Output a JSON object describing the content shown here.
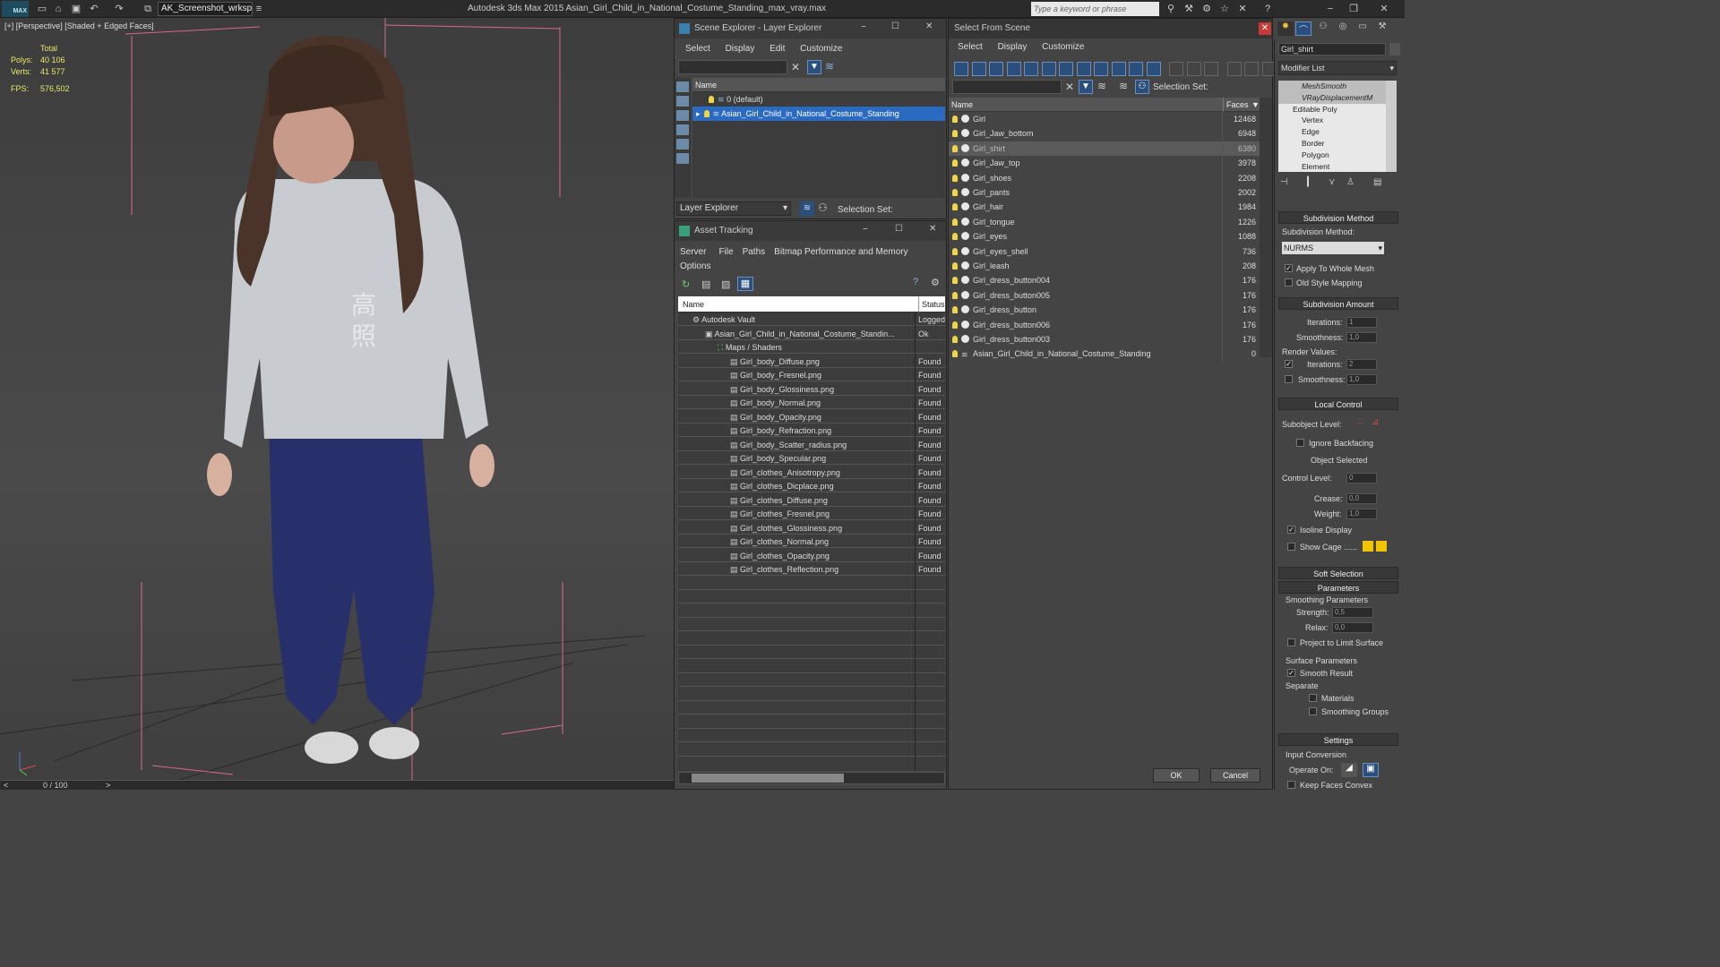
{
  "app": {
    "logo": "MAX",
    "workspace": "AK_Screenshot_wrksp",
    "title": "Autodesk 3ds Max  2015      Asian_Girl_Child_in_National_Costume_Standing_max_vray.max",
    "search_placeholder": "Type a keyword or phrase"
  },
  "viewport": {
    "label": "[+] [Perspective] [Shaded + Edged Faces]",
    "stats": {
      "total_label": "Total",
      "polys_label": "Polys:",
      "polys": "40 106",
      "verts_label": "Verts:",
      "verts": "41 577",
      "fps_label": "FPS:",
      "fps": "576,502"
    },
    "chars": [
      "高",
      "照"
    ]
  },
  "timeline": {
    "frame": "0 / 100",
    "left": "<",
    "right": ">"
  },
  "scene_explorer": {
    "title": "Scene Explorer - Layer Explorer",
    "menu": [
      "Select",
      "Display",
      "Edit",
      "Customize"
    ],
    "col_name": "Name",
    "layers": [
      "0 (default)",
      "Asian_Girl_Child_in_National_Costume_Standing"
    ],
    "footer_dropdown": "Layer Explorer",
    "footer_selset": "Selection Set:"
  },
  "asset_tracking": {
    "title": "Asset Tracking",
    "menu": [
      "Server",
      "File",
      "Paths",
      "Bitmap Performance and Memory",
      "Options"
    ],
    "col_name": "Name",
    "col_status": "Status",
    "rows": [
      {
        "name": "Autodesk Vault",
        "status": "Logged",
        "indent": 1
      },
      {
        "name": "Asian_Girl_Child_in_National_Costume_Standin...",
        "status": "Ok",
        "indent": 2
      },
      {
        "name": "Maps / Shaders",
        "status": "",
        "indent": 3
      },
      {
        "name": "Girl_body_Diffuse.png",
        "status": "Found",
        "indent": 4
      },
      {
        "name": "Girl_body_Fresnel.png",
        "status": "Found",
        "indent": 4
      },
      {
        "name": "Girl_body_Glossiness.png",
        "status": "Found",
        "indent": 4
      },
      {
        "name": "Girl_body_Normal.png",
        "status": "Found",
        "indent": 4
      },
      {
        "name": "Girl_body_Opacity.png",
        "status": "Found",
        "indent": 4
      },
      {
        "name": "Girl_body_Refraction.png",
        "status": "Found",
        "indent": 4
      },
      {
        "name": "Girl_body_Scatter_radius.png",
        "status": "Found",
        "indent": 4
      },
      {
        "name": "Girl_body_Specular.png",
        "status": "Found",
        "indent": 4
      },
      {
        "name": "Girl_clothes_Anisotropy.png",
        "status": "Found",
        "indent": 4
      },
      {
        "name": "Girl_clothes_Dicplace.png",
        "status": "Found",
        "indent": 4
      },
      {
        "name": "Girl_clothes_Diffuse.png",
        "status": "Found",
        "indent": 4
      },
      {
        "name": "Girl_clothes_Fresnel.png",
        "status": "Found",
        "indent": 4
      },
      {
        "name": "Girl_clothes_Glossiness.png",
        "status": "Found",
        "indent": 4
      },
      {
        "name": "Girl_clothes_Normal.png",
        "status": "Found",
        "indent": 4
      },
      {
        "name": "Girl_clothes_Opacity.png",
        "status": "Found",
        "indent": 4
      },
      {
        "name": "Girl_clothes_Reflection.png",
        "status": "Found",
        "indent": 4
      }
    ]
  },
  "select_from_scene": {
    "title": "Select From Scene",
    "menu": [
      "Select",
      "Display",
      "Customize"
    ],
    "selset": "Selection Set:",
    "col_name": "Name",
    "col_faces": "Faces",
    "objects": [
      {
        "name": "Girl",
        "faces": "12468"
      },
      {
        "name": "Girl_Jaw_bottom",
        "faces": "6948"
      },
      {
        "name": "Girl_shirt",
        "faces": "6380",
        "selected": true
      },
      {
        "name": "Girl_Jaw_top",
        "faces": "3978"
      },
      {
        "name": "Girl_shoes",
        "faces": "2208"
      },
      {
        "name": "Girl_pants",
        "faces": "2002"
      },
      {
        "name": "Girl_hair",
        "faces": "1984"
      },
      {
        "name": "Girl_tongue",
        "faces": "1226"
      },
      {
        "name": "Girl_eyes",
        "faces": "1088"
      },
      {
        "name": "Girl_eyes_shell",
        "faces": "736"
      },
      {
        "name": "Girl_leash",
        "faces": "208"
      },
      {
        "name": "Girl_dress_button004",
        "faces": "176"
      },
      {
        "name": "Girl_dress_button005",
        "faces": "176"
      },
      {
        "name": "Girl_dress_button",
        "faces": "176"
      },
      {
        "name": "Girl_dress_button006",
        "faces": "176"
      },
      {
        "name": "Girl_dress_button003",
        "faces": "176"
      },
      {
        "name": "Asian_Girl_Child_in_National_Costume_Standing",
        "faces": "0"
      }
    ],
    "ok": "OK",
    "cancel": "Cancel"
  },
  "command_panel": {
    "object_name": "Girl_shirt",
    "modifier_list": "Modifier List",
    "stack": [
      "MeshSmooth",
      "VRayDisplacementM",
      "Editable Poly",
      "Vertex",
      "Edge",
      "Border",
      "Polygon",
      "Element"
    ],
    "subdiv_method_title": "Subdivision Method",
    "subdiv_method_label": "Subdivision Method:",
    "subdiv_method": "NURMS",
    "apply_whole": "Apply To Whole Mesh",
    "old_style": "Old Style Mapping",
    "subdiv_amount_title": "Subdivision Amount",
    "iterations_label": "Iterations:",
    "iterations": "1",
    "smoothness_label": "Smoothness:",
    "smoothness": "1,0",
    "render_values": "Render Values:",
    "r_iterations": "2",
    "r_smoothness": "1,0",
    "local_control_title": "Local Control",
    "subobject_label": "Subobject Level:",
    "ignore_backfacing": "Ignore Backfacing",
    "object_selected": "Object Selected",
    "control_level_label": "Control Level:",
    "control_level": "0",
    "crease_label": "Crease:",
    "crease": "0,0",
    "weight_label": "Weight:",
    "weight": "1,0",
    "isoline": "Isoline Display",
    "show_cage": "Show Cage ......",
    "soft_sel_title": "Soft Selection",
    "params_title": "Parameters",
    "smoothing_params": "Smoothing Parameters",
    "strength_label": "Strength:",
    "strength": "0,5",
    "relax_label": "Relax:",
    "relax": "0,0",
    "project_limit": "Project to Limit Surface",
    "surface_params": "Surface Parameters",
    "smooth_result": "Smooth Result",
    "separate": "Separate",
    "materials": "Materials",
    "smoothing_groups": "Smoothing Groups",
    "settings_title": "Settings",
    "input_conversion": "Input Conversion",
    "operate_on": "Operate On:",
    "keep_faces_convex": "Keep Faces Convex"
  },
  "colors": {
    "accent": "#2b4f7c",
    "selection": "#1e6ad4",
    "cage_yellow": "#f2c400"
  }
}
